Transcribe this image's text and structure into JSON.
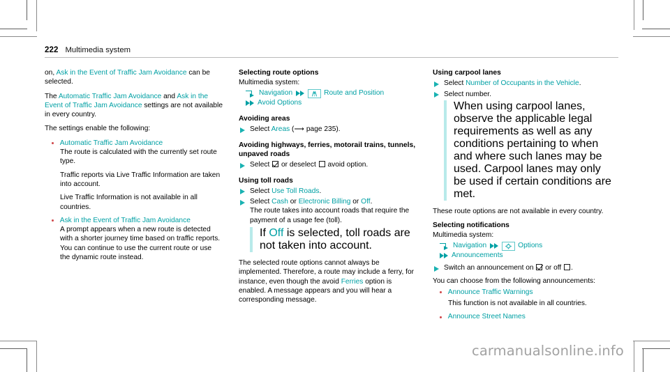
{
  "header": {
    "page_number": "222",
    "title": "Multimedia system"
  },
  "watermark": "carmanualsonline.info",
  "colors": {
    "teal": "#00a0a4",
    "step_arrow": "#19b2b2",
    "indent_rule": "#b8eaea",
    "bullet": "#d0494c"
  },
  "left_column": {
    "para_1_pre": "on, ",
    "para_1_link": "Ask in the Event of Traffic Jam Avoidance",
    "para_1_post": " can be selected.",
    "para_2_pre": "The ",
    "para_2_link_a": "Automatic Traffic Jam Avoidance",
    "para_2_mid": " and ",
    "para_2_link_b": "Ask in the Event of Traffic Jam Avoidance",
    "para_2_post": " settings are not available in every country.",
    "para_3": "The settings enable the following:",
    "bullets": [
      {
        "label": "Automatic Traffic Jam Avoidance",
        "paras": [
          "The route is calculated with the currently set route type.",
          "Traffic reports via Live Traffic Information are taken into account.",
          "Live Traffic Information is not available in all countries."
        ]
      },
      {
        "label": "Ask in the Event of Traffic Jam Avoidance",
        "paras": [
          "A prompt appears when a new route is detected with a shorter journey time based on traffic reports. You can continue to use the current route or use the dynamic route instead."
        ]
      }
    ]
  },
  "middle_column": {
    "heading_1": "Selecting route options",
    "lead_1": "Multimedia system:",
    "path_1": {
      "enter_icon": "enter-menu-icon",
      "item_1": "Navigation",
      "chevron_icon": "double-chevron-icon",
      "box_icon_1": "route-and-position-icon",
      "item_2": "Route and Position",
      "item_3": "Avoid Options"
    },
    "heading_2": "Avoiding areas",
    "step_1_pre": "Select ",
    "step_1_link": "Areas",
    "step_1_post": " (⟶ page 235).",
    "heading_3": "Avoiding highways, ferries, motorail trains, tunnels, unpaved roads",
    "step_2_a": "Select ",
    "step_2_b": " or deselect ",
    "step_2_c": " avoid option.",
    "heading_4": "Using toll roads",
    "step_3_pre": "Select ",
    "step_3_link": "Use Toll Roads",
    "step_3_post": ".",
    "step_4_pre": "Select ",
    "step_4_link_a": "Cash",
    "step_4_mid": " or ",
    "step_4_link_b": "Electronic Billing",
    "step_4_mid_2": " or ",
    "step_4_link_c": "Off",
    "step_4_post": ".",
    "step_4_note_1": "The route takes into account roads that require the payment of a usage fee (toll).",
    "step_4_note_2_pre": "If ",
    "step_4_note_2_link": "Off",
    "step_4_note_2_post": " is selected, toll roads are not taken into account.",
    "closing_pre": "The selected route options cannot always be implemented. Therefore, a route may include a ferry, for instance, even though the avoid ",
    "closing_link": "Ferries",
    "closing_post": " option is enabled. A message appears and you will hear a corresponding message."
  },
  "right_column": {
    "heading_1": "Using carpool lanes",
    "step_1_pre": "Select ",
    "step_1_link": "Number of Occupants in the Vehicle",
    "step_1_post": ".",
    "step_2_line": "Select number.",
    "step_2_note": "When using carpool lanes, observe the applicable legal requirements as well as any conditions pertaining to when and where such lanes may be used. Carpool lanes may only be used if certain conditions are met.",
    "para_1": "These route options are not available in every country.",
    "heading_2": "Selecting notifications",
    "lead_1": "Multimedia system:",
    "path_1": {
      "enter_icon": "enter-menu-icon",
      "item_1": "Navigation",
      "chevron_icon": "double-chevron-icon",
      "box_icon_1": "options-gear-icon",
      "item_2": "Options",
      "item_3": "Announcements"
    },
    "step_3_a": "Switch an announcement on ",
    "step_3_b": " or off ",
    "step_3_c": ".",
    "para_2": "You can choose from the following announcements:",
    "bullets": [
      {
        "label": "Announce Traffic Warnings",
        "note": "This function is not available in all countries."
      },
      {
        "label": "Announce Street Names",
        "note": ""
      }
    ]
  }
}
